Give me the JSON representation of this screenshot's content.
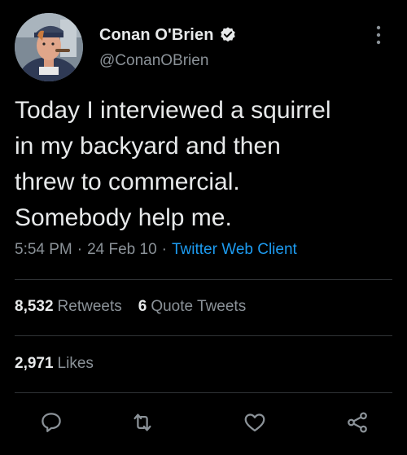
{
  "author": {
    "display_name": "Conan O'Brien",
    "handle": "@ConanOBrien",
    "verified_icon": "verified-badge-icon",
    "avatar": "avatar"
  },
  "tweet": {
    "text": "Today I interviewed a squirrel\nin my backyard and then\nthrew to commercial.\nSomebody help me.",
    "time": "5:54 PM",
    "separator": "·",
    "date": "24 Feb 10",
    "client": "Twitter Web Client"
  },
  "stats": {
    "retweets_count": "8,532",
    "retweets_label": "Retweets",
    "quotes_count": "6",
    "quotes_label": "Quote Tweets",
    "likes_count": "2,971",
    "likes_label": "Likes"
  },
  "actions": [
    "reply-icon",
    "retweet-icon",
    "like-icon",
    "share-icon"
  ],
  "colors": {
    "background": "#000000",
    "text": "#e7e9ea",
    "secondary": "#8b9298",
    "link": "#1d9bf0",
    "divider": "#2f3336"
  }
}
